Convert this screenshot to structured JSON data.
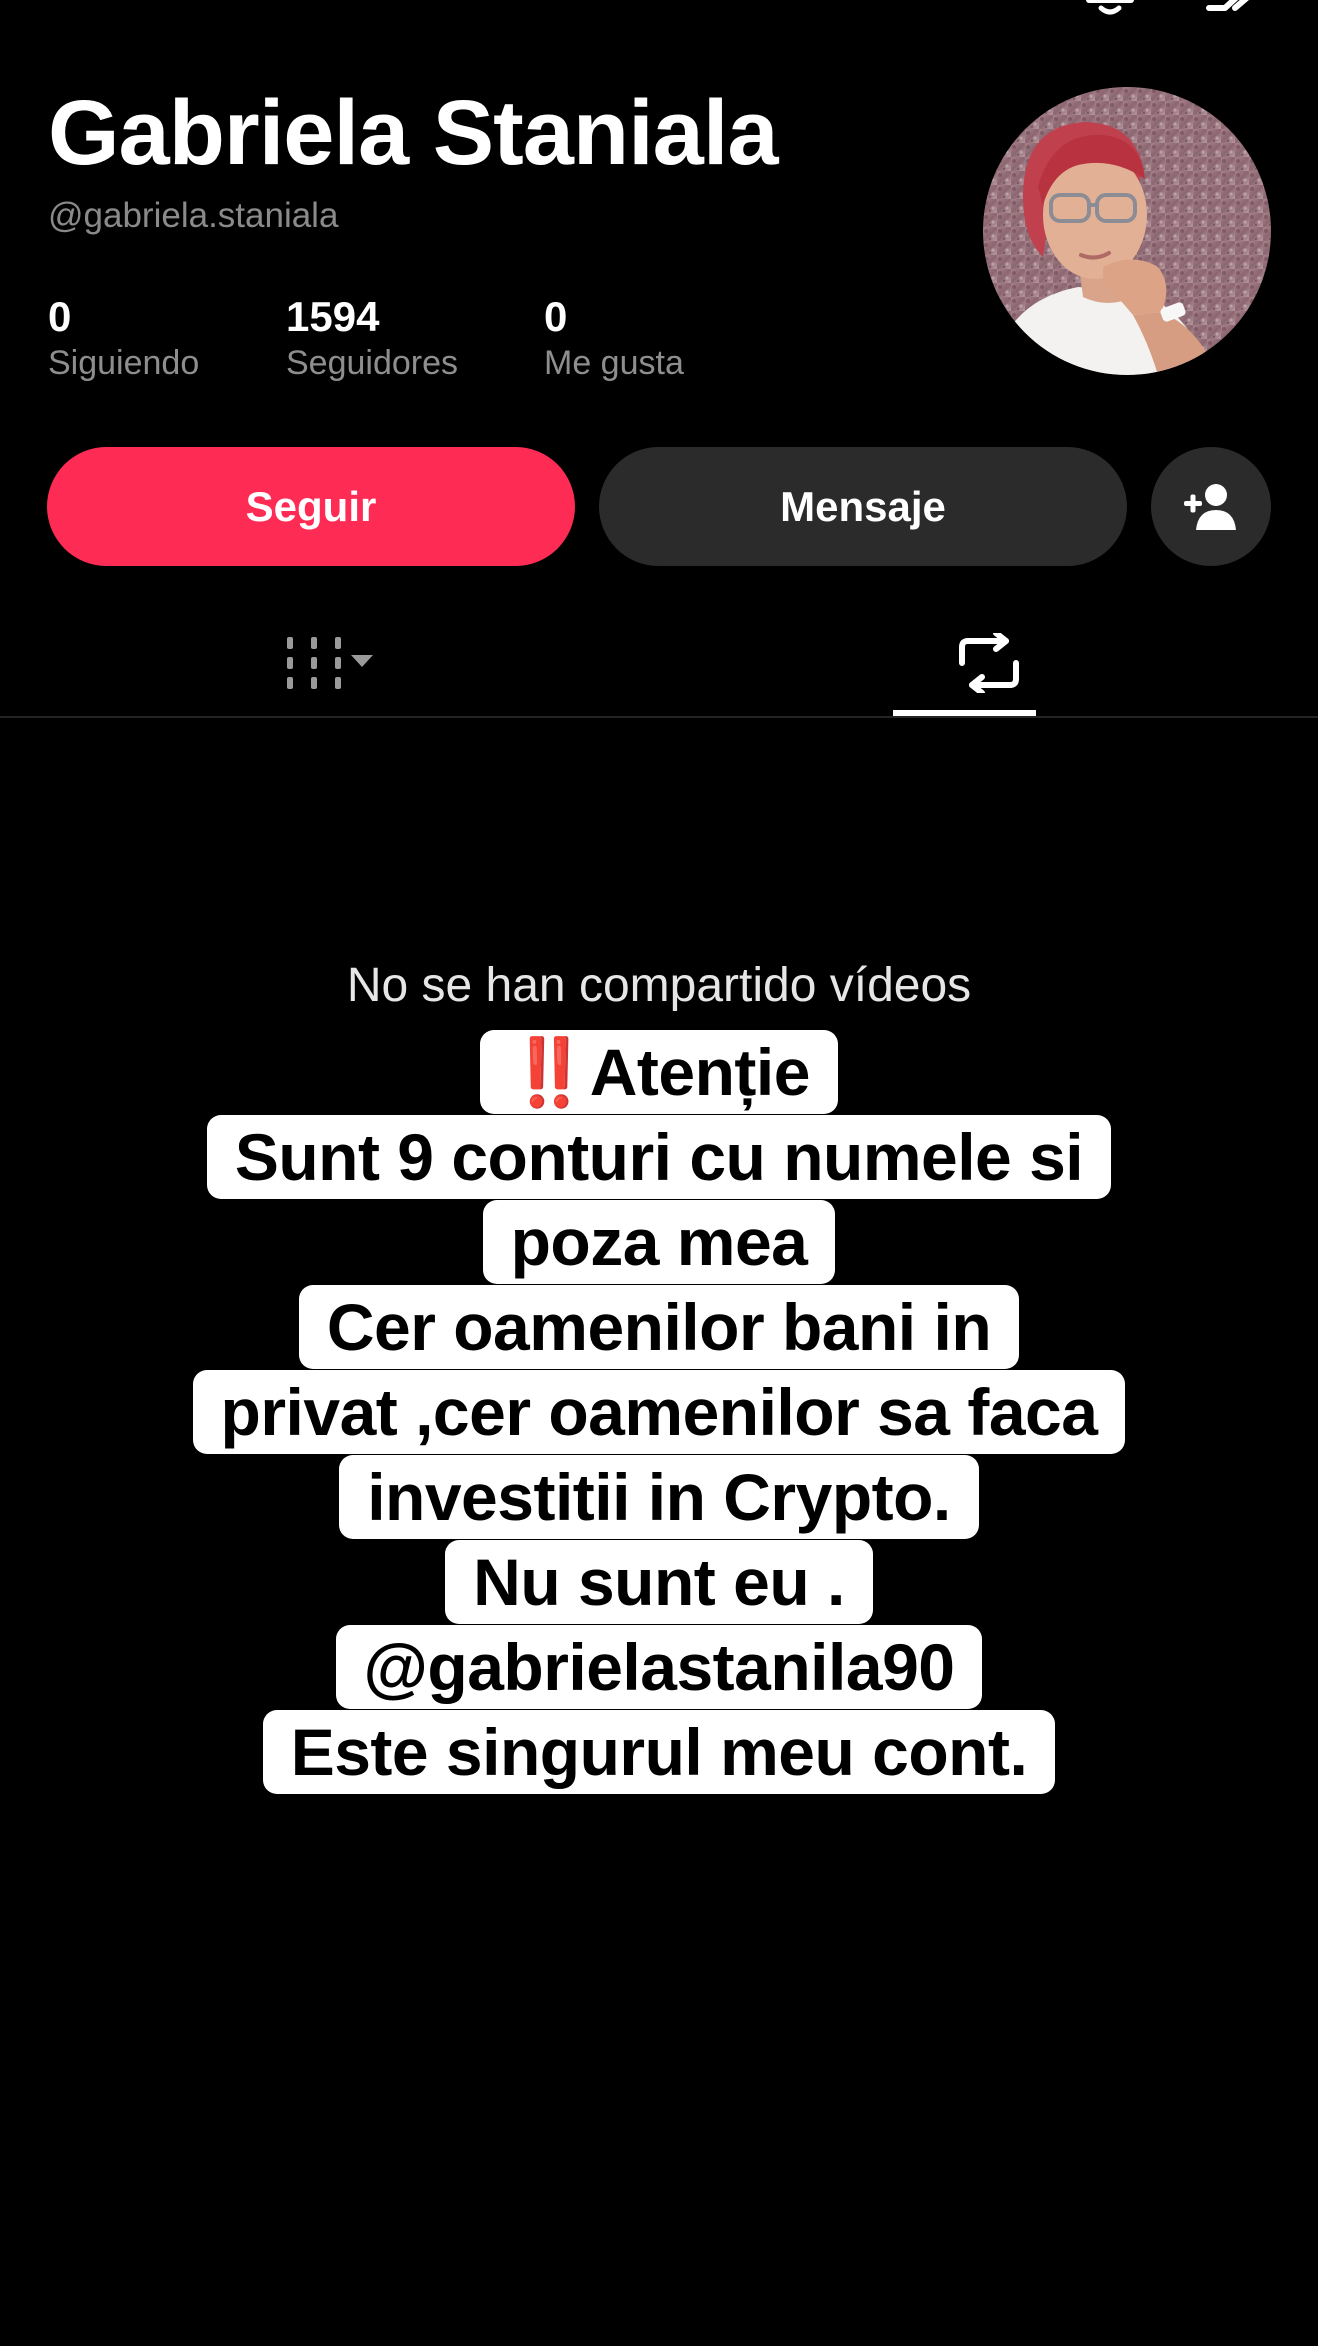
{
  "profile": {
    "display_name": "Gabriela Staniala",
    "username": "@gabriela.staniala",
    "stats": [
      {
        "value": "0",
        "label": "Siguiendo"
      },
      {
        "value": "1594",
        "label": "Seguidores"
      },
      {
        "value": "0",
        "label": "Me gusta"
      }
    ]
  },
  "actions": {
    "follow_label": "Seguir",
    "message_label": "Mensaje"
  },
  "tabs": {
    "videos_icon": "grid-icon",
    "reposts_icon": "repost-icon",
    "active": "reposts"
  },
  "content": {
    "empty_message": "No se han compartido vídeos",
    "sticker_warning_emoji": "‼️",
    "sticker_lines": [
      "Atenție",
      "Sunt 9 conturi cu numele si",
      "poza mea",
      "Cer oamenilor bani in",
      "privat ,cer oamenilor sa faca",
      "investitii in Crypto.",
      "Nu sunt eu .",
      "@gabrielastanila90",
      "Este singurul meu cont."
    ]
  },
  "colors": {
    "background": "#000000",
    "accent": "#fe2c55",
    "secondary_button": "#2b2b2b",
    "muted_text": "#8a8a8a"
  }
}
